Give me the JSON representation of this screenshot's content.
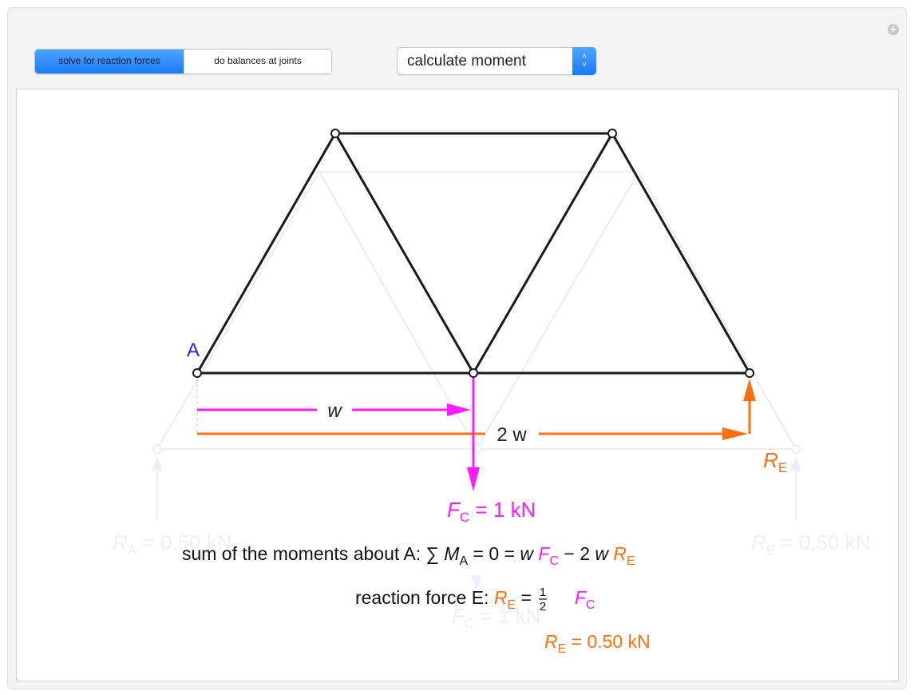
{
  "controls": {
    "mode_tabs": [
      {
        "label": "solve for reaction forces",
        "active": true
      },
      {
        "label": "do balances at joints",
        "active": false
      }
    ],
    "calc_menu": {
      "selected": "calculate moment"
    },
    "add_icon": "plus-circle-icon"
  },
  "colors": {
    "member": "#1a1a1a",
    "load": "#ff1aff",
    "reaction": "#ff6e0f",
    "label_A": "#1f1fff",
    "ghost": "#ececf4",
    "ghost_text": "#eeeefa"
  },
  "diagram": {
    "node_label_A": "A",
    "w_label": "w",
    "two_w_label": "2 w",
    "re_symbol": "R",
    "re_sub": "E",
    "fc_symbol": "F",
    "fc_sub": "C",
    "fc_value": " = 1 kN",
    "ghost_ra": {
      "symbol": "R",
      "sub": "A",
      "value": " = 0.50 kN"
    },
    "ghost_re": {
      "symbol": "R",
      "sub": "E",
      "value": " = 0.50 kN"
    },
    "ghost_fc": {
      "symbol": "F",
      "sub": "C",
      "value": " = 1 kN"
    }
  },
  "equations": {
    "moment_prefix": "sum of the moments about A: ∑ ",
    "moment_M": "M",
    "moment_M_sub": "A",
    "moment_mid": " = 0 = ",
    "w": "w",
    "space": " ",
    "minus_2": " − 2 ",
    "reaction_prefix": "reaction force E: ",
    "eq": " = ",
    "half_num": "1",
    "half_den": "2",
    "result_value": " = 0.50 kN"
  }
}
